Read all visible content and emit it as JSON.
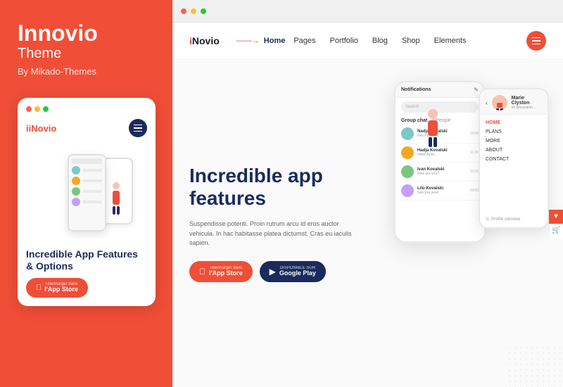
{
  "left_panel": {
    "brand_name": "Innovio",
    "brand_line2": "Theme",
    "brand_by": "By Mikado-Themes",
    "card": {
      "logo": "iNovio",
      "phone_heading": "Incredible App Features & Options",
      "appstore_sub": "Télécharger dans",
      "appstore_main": "l'App Store"
    }
  },
  "browser": {
    "dots": [
      "red",
      "yellow",
      "green"
    ]
  },
  "website": {
    "logo": "iNovio",
    "nav": {
      "arrow": "→",
      "home": "Home",
      "links": [
        "Pages",
        "Portfolio",
        "Blog",
        "Shop",
        "Elements"
      ]
    },
    "hero": {
      "title_line1": "Incredible app",
      "title_line2": "features",
      "description": "Suspendisse potenti. Proin rutrum arcu id eros auctor vehicula.\nIn hac habitasse platea dictumst. Cras eu iaculis sapien.",
      "btn_appstore_sub": "Télécharger dans",
      "btn_appstore_main": "l'App Store",
      "btn_google_sub": "DISPONIBLE SUR",
      "btn_google_main": "Google Play"
    },
    "phone_main": {
      "header_title": "Notifications",
      "search_placeholder": "Search",
      "group_label": "Group chat",
      "group_count": "4 People",
      "contacts": [
        {
          "name": "Nadja Kovalski",
          "msg": "Hey Kovalski...",
          "time": "12:04",
          "color": "#7ec8c8"
        },
        {
          "name": "Hadja Kovalski",
          "msg": "Hello there...",
          "time": "11:30",
          "color": "#f5a623"
        },
        {
          "name": "Ivan Kovalski",
          "msg": "How are you?",
          "time": "10:15",
          "color": "#7bc67e"
        },
        {
          "name": "Lilo Kovalski",
          "msg": "See you soon",
          "time": "09:50",
          "color": "#c4a0f5"
        }
      ]
    },
    "phone_secondary": {
      "person_name": "Marie Clyston",
      "person_status": "en discussion...",
      "nav_items": [
        "HOME",
        "PLANS",
        "MORE",
        "ABOUT",
        "CONTACT"
      ],
      "active_nav": "HOME",
      "profile_link": "Profile connexe"
    }
  },
  "sidebar_right": {
    "icons": [
      "♥",
      "🛒"
    ]
  }
}
